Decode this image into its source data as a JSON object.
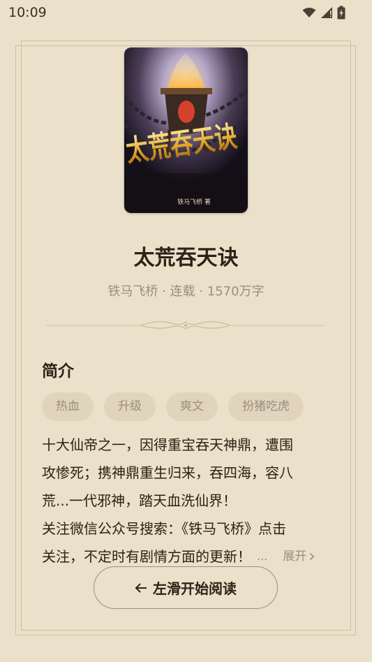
{
  "status_bar": {
    "time": "10:09",
    "icons": [
      "wifi-icon",
      "signal-icon",
      "battery-icon"
    ]
  },
  "book": {
    "cover": {
      "title_art": "太荒吞天诀",
      "author_art": "铁马飞桥 著"
    },
    "title": "太荒吞天诀",
    "meta": "铁马飞桥 · 连载 · 1570万字"
  },
  "intro": {
    "heading": "简介",
    "tags": [
      "热血",
      "升级",
      "爽文",
      "扮猪吃虎"
    ],
    "lines": [
      "十大仙帝之一，因得重宝吞天神鼎，遭围",
      "攻惨死；携神鼎重生归来，吞四海，容八",
      "荒...一代邪神，踏天血洗仙界！",
      "关注微信公众号搜索：《铁马飞桥》点击"
    ],
    "last_line": "关注，不定时有剧情方面的更新！",
    "ellipsis": "...",
    "expand_label": "展开"
  },
  "actions": {
    "read_label": "左滑开始阅读"
  },
  "colors": {
    "background": "#ebe0c9",
    "text_primary": "#2c2217",
    "text_secondary": "#9a8f7f",
    "tag_background": "#e0d4bc"
  }
}
